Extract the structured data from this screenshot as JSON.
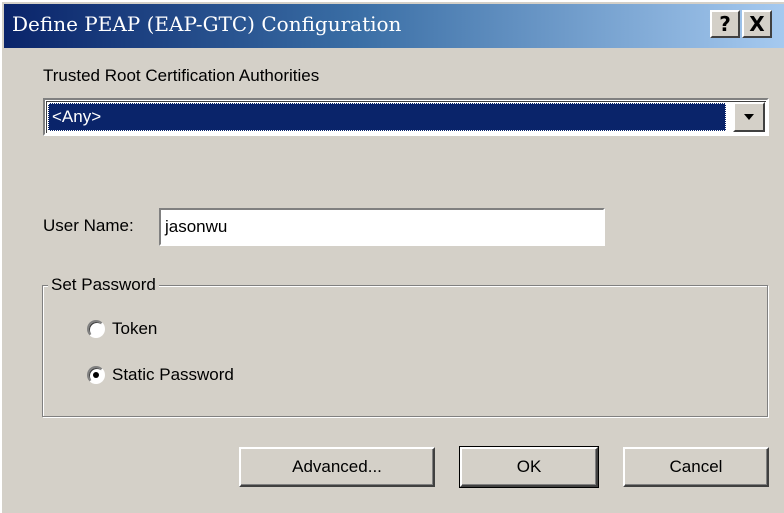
{
  "window": {
    "title": "Define PEAP (EAP-GTC) Configuration",
    "help_glyph": "?",
    "close_glyph": "X",
    "titlebar_color": "#0a246a"
  },
  "cert": {
    "label": "Trusted Root Certification Authorities",
    "selected": "<Any>"
  },
  "user": {
    "label": "User Name:",
    "value": "jasonwu"
  },
  "password_group": {
    "legend": "Set Password",
    "options": [
      {
        "label": "Token",
        "checked": false
      },
      {
        "label": "Static Password",
        "checked": true
      }
    ]
  },
  "buttons": {
    "advanced": "Advanced...",
    "ok": "OK",
    "cancel": "Cancel"
  },
  "icons": {
    "dropdown": "chevron-down-icon",
    "help": "help-icon",
    "close": "close-icon"
  }
}
